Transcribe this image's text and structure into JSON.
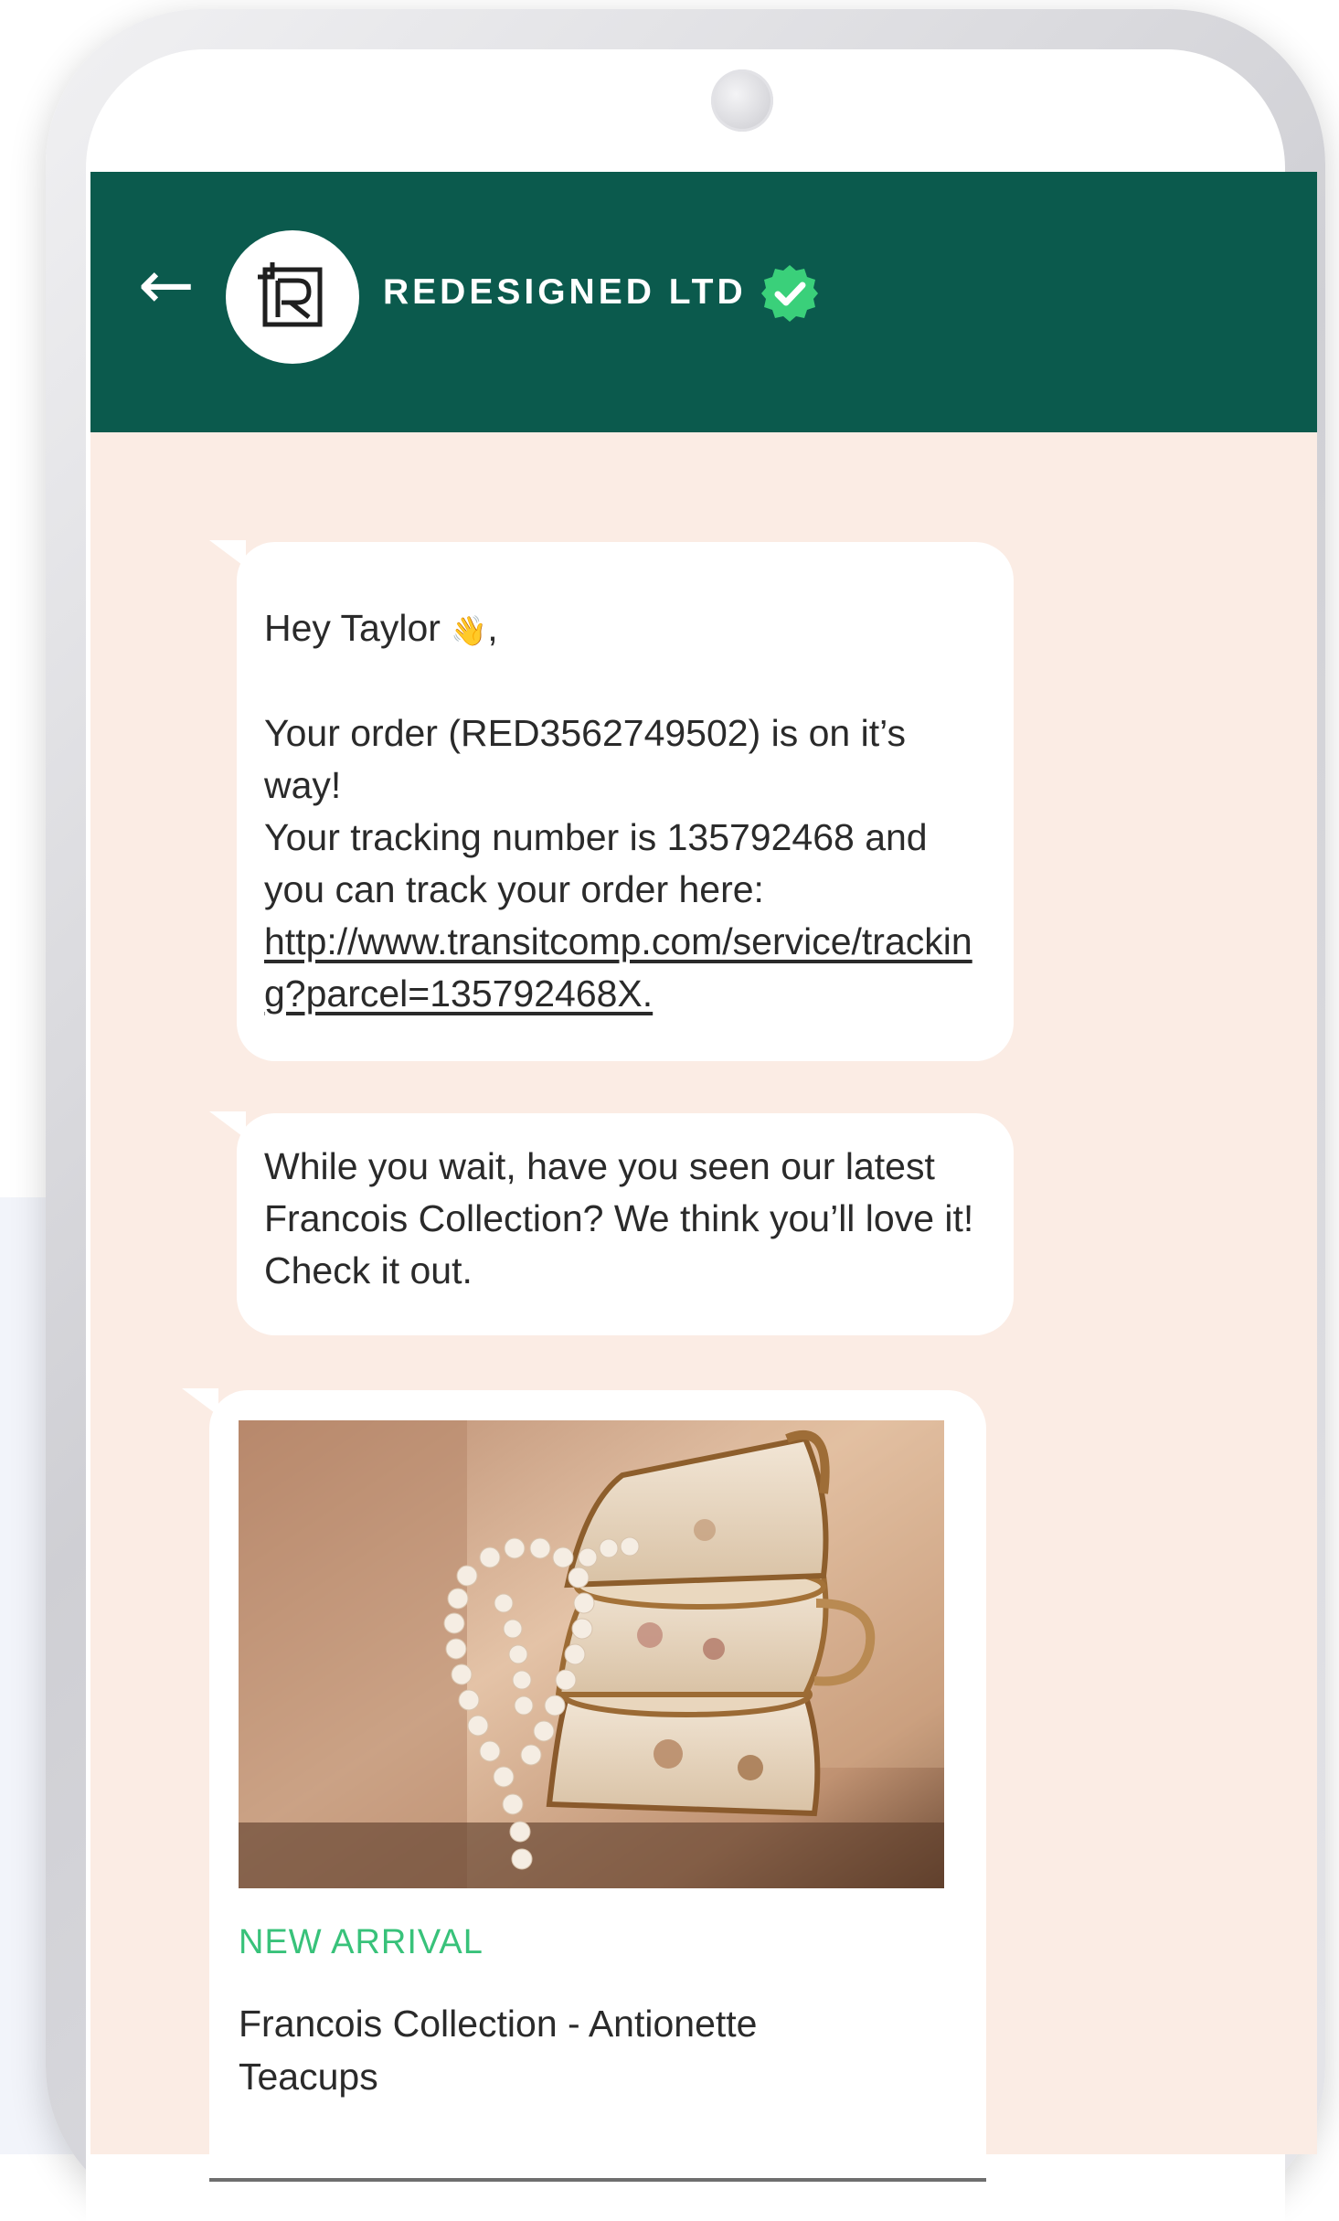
{
  "header": {
    "back_icon": "arrow-left-icon",
    "business_name": "REDESIGNED LTD",
    "verified_icon": "verified-check-icon",
    "colors": {
      "header_bg": "#0b5a4d",
      "verified": "#3ad07a"
    }
  },
  "chat": {
    "background": "#fbece4",
    "messages": [
      {
        "greeting": "Hey Taylor",
        "greeting_emoji": "👋",
        "greeting_suffix": ",",
        "line1": "Your order (RED3562749502) is on it’s way!",
        "line2": "Your tracking number is 135792468 and you can track your order here:",
        "link": "http://www.transitcomp.com/service/tracking?parcel=135792468X."
      },
      {
        "text": "While you wait, have you seen our latest Francois Collection? We think you’ll love it! Check it out."
      }
    ],
    "product_card": {
      "image_icon": "teacups-with-pearls-photo",
      "badge": "NEW ARRIVAL",
      "title": "Francois Collection - Antionette Teacups"
    }
  }
}
